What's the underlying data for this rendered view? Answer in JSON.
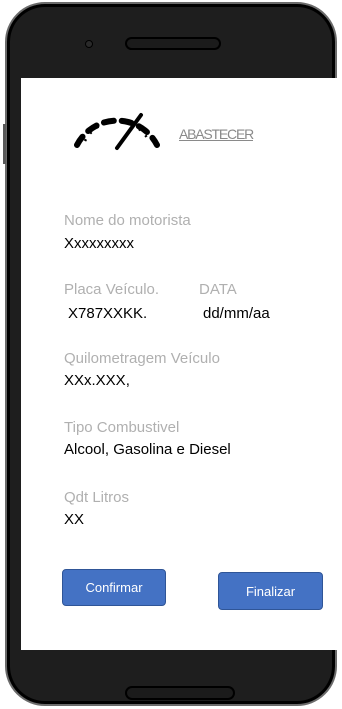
{
  "header": {
    "brand": "ABASTECER"
  },
  "form": {
    "driver": {
      "label": "Nome do motorista",
      "value": "Xxxxxxxxx"
    },
    "plate": {
      "label": "Placa Veículo.",
      "value": "X787XXKK."
    },
    "date": {
      "label": "DATA",
      "value": "dd/mm/aa"
    },
    "mileage": {
      "label": "Quilometragem Veículo",
      "value": "XXx.XXX,"
    },
    "fuel": {
      "label": "Tipo Combustivel",
      "value": "Alcool, Gasolina e Diesel"
    },
    "liters": {
      "label": "Qdt Litros",
      "value": "XX"
    }
  },
  "actions": {
    "confirm_label": "Confirmar",
    "finish_label": "Finalizar"
  },
  "colors": {
    "button": "#4472c4",
    "label": "#b0b0b0",
    "frame": "#1e1e1e"
  },
  "icons": {
    "logo": "speedometer-icon"
  }
}
